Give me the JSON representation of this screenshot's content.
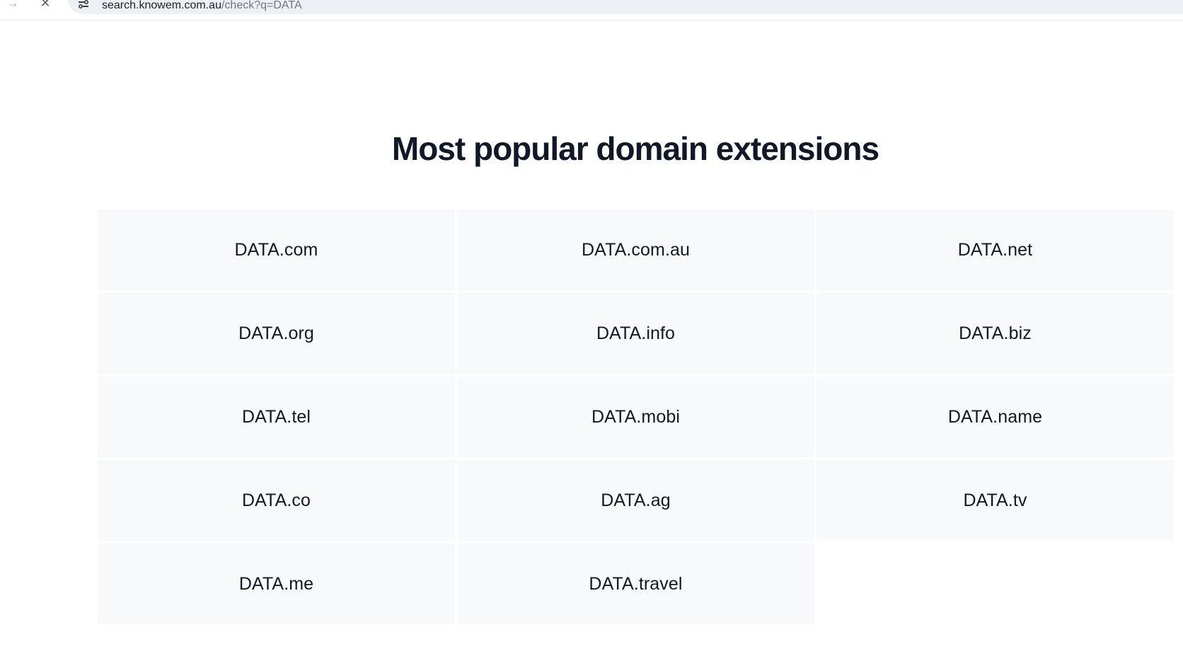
{
  "browser": {
    "url_host": "search.knowem.com.au",
    "url_path": "/check?q=DATA"
  },
  "page": {
    "title": "Most popular domain extensions"
  },
  "extensions": [
    "DATA.com",
    "DATA.com.au",
    "DATA.net",
    "DATA.org",
    "DATA.info",
    "DATA.biz",
    "DATA.tel",
    "DATA.mobi",
    "DATA.name",
    "DATA.co",
    "DATA.ag",
    "DATA.tv",
    "DATA.me",
    "DATA.travel"
  ]
}
